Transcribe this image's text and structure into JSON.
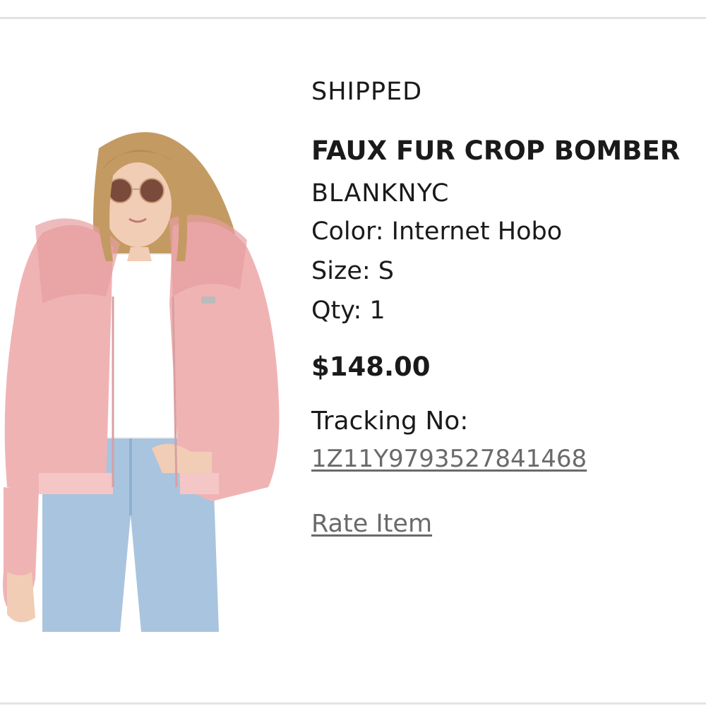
{
  "order_item": {
    "status": "SHIPPED",
    "product_name": "FAUX FUR CROP BOMBER",
    "brand": "BLANKNYC",
    "color_line": "Color: Internet Hobo",
    "size_line": "Size: S",
    "qty_line": "Qty: 1",
    "price": "$148.00",
    "tracking_label": "Tracking No:",
    "tracking_number": "1Z11Y9793527841468",
    "rate_label": "Rate Item"
  },
  "image": {
    "subject": "model-wearing-pink-faux-fur-bomber-jacket",
    "colors": {
      "jacket": "#f0b3b4",
      "jacket_shadow": "#e59ea0",
      "tshirt": "#ffffff",
      "jeans": "#a9c4df",
      "hair": "#c49a63",
      "skin": "#f1cdb5"
    }
  },
  "colors": {
    "text": "#1a1a1a",
    "link": "#6a6a6a",
    "divider": "#e3e3e3"
  }
}
